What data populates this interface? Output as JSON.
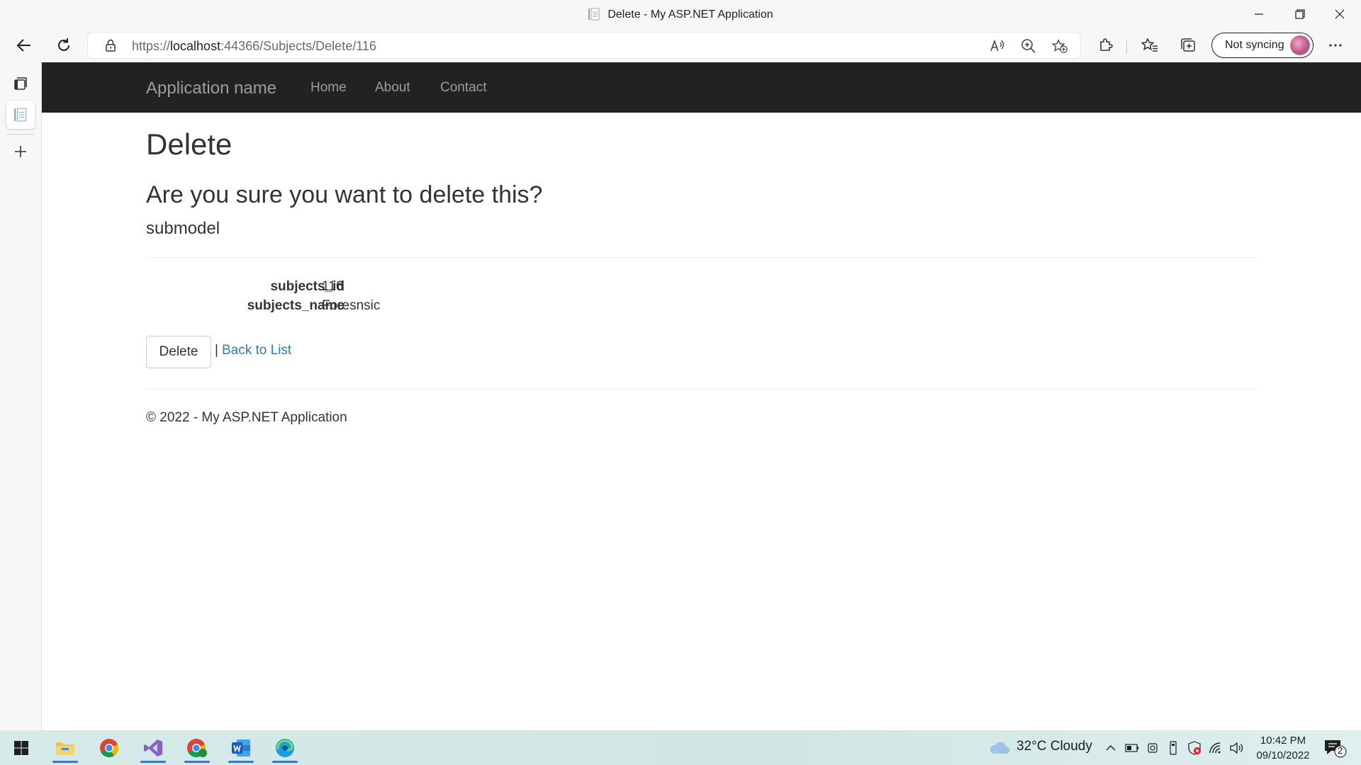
{
  "window": {
    "title": "Delete - My ASP.NET Application",
    "url_prefix": "https://",
    "url_host": "localhost",
    "url_rest": ":44366/Subjects/Delete/116",
    "sync_label": "Not syncing"
  },
  "app": {
    "brand": "Application name",
    "nav": [
      "Home",
      "About",
      "Contact"
    ]
  },
  "page": {
    "heading": "Delete",
    "confirm": "Are you sure you want to delete this?",
    "model_name": "submodel",
    "fields": [
      {
        "label": "subjects_id",
        "value": "116"
      },
      {
        "label": "subjects_name",
        "value": "Foresnsic"
      }
    ],
    "delete_button": "Delete",
    "separator": "|",
    "back_link": "Back to List",
    "footer": "© 2022 - My ASP.NET Application"
  },
  "taskbar": {
    "weather": "32°C  Cloudy",
    "time": "10:42 PM",
    "date": "09/10/2022",
    "notification_count": "2"
  },
  "icons": {
    "favicon": "page-icon",
    "back": "back-arrow-icon",
    "refresh": "refresh-icon",
    "lock": "lock-icon",
    "read_aloud": "read-aloud-icon",
    "zoom": "zoom-icon",
    "add_favorite": "add-favorite-icon",
    "extensions": "extensions-icon",
    "favorites": "favorites-icon",
    "collections": "collections-icon",
    "more": "more-icon"
  },
  "colors": {
    "navbar": "#222222",
    "nav_text": "#9d9d9d",
    "link": "#337ab7",
    "taskbar_accent": "#3a78c3"
  }
}
